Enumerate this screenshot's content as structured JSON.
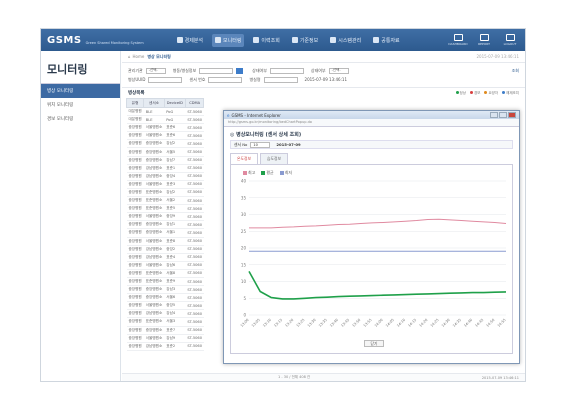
{
  "app": {
    "logo": "GSMS",
    "logo_sub": "Green Shared Monitoring System",
    "menu": [
      "경제분석",
      "모니터링",
      "이력조회",
      "기준정보",
      "시스템관리",
      "공통자료"
    ],
    "right_icons": [
      "DASHBOARD",
      "REPORT",
      "LOGOUT"
    ]
  },
  "sidebar": {
    "title": "모니터링",
    "items": [
      "병상 모니터링",
      "위치 모니터링",
      "경보 모니터링"
    ]
  },
  "crumb": {
    "home": "Home",
    "current": "병상 모니터링",
    "info": "2015-07-09 13:46:11"
  },
  "filters": {
    "org_label": "관리기관",
    "org_value": "-선택-",
    "ward_label": "병동/병실정보",
    "status_label": "상태여부",
    "status_value": "-선택-",
    "search_label": "조회",
    "name_label": "병상UUID",
    "bedid_label": "센서 번호",
    "ip_label": "병실명",
    "time_value": "2015-07-09 13:46:11"
  },
  "list": {
    "title": "병상목록",
    "legend": [
      "정상",
      "경보",
      "요양자",
      "해제조치"
    ],
    "legend_colors": [
      "#1fa04a",
      "#d94040",
      "#e08a1e",
      "#3d7cc9"
    ],
    "headers": [
      "유형",
      "센서소",
      "DeviceID",
      "CDMA"
    ],
    "rows": [
      [
        "대분병원",
        "BLE",
        "PoG",
        "ST-5060"
      ],
      [
        "대분병원",
        "BLE",
        "PoG",
        "ST-5060"
      ],
      [
        "중앙병원",
        "서울병원소",
        "표준6",
        "ST-5060"
      ],
      [
        "중앙병원",
        "서울병원소",
        "표준6",
        "ST-5060"
      ],
      [
        "중앙병원",
        "중앙병원소",
        "강남2",
        "ST-5060"
      ],
      [
        "중앙병원",
        "중앙병원소",
        "서울5",
        "ST-5060"
      ],
      [
        "중앙병원",
        "중앙병원소",
        "강남7",
        "ST-5060"
      ],
      [
        "중앙병원",
        "강남병원소",
        "표준1",
        "ST-5060"
      ],
      [
        "중앙병원",
        "강남병원소",
        "중앙4",
        "ST-5060"
      ],
      [
        "중앙병원",
        "서울병원소",
        "표준3",
        "ST-5060"
      ],
      [
        "중앙병원",
        "표준병원소",
        "강남2",
        "ST-5060"
      ],
      [
        "중앙병원",
        "표준병원소",
        "서울2",
        "ST-5060"
      ],
      [
        "중앙병원",
        "표준병원소",
        "표준5",
        "ST-5060"
      ],
      [
        "중앙병원",
        "서울병원소",
        "중앙9",
        "ST-5060"
      ],
      [
        "중앙병원",
        "중앙병원소",
        "강남1",
        "ST-5060"
      ],
      [
        "중앙병원",
        "중앙병원소",
        "서울1",
        "ST-5060"
      ],
      [
        "중앙병원",
        "서울병원소",
        "표준8",
        "ST-5060"
      ],
      [
        "중앙병원",
        "강남병원소",
        "중앙2",
        "ST-5060"
      ],
      [
        "중앙병원",
        "강남병원소",
        "표준4",
        "ST-5060"
      ],
      [
        "중앙병원",
        "서울병원소",
        "강남6",
        "ST-5060"
      ],
      [
        "중앙병원",
        "표준병원소",
        "서울8",
        "ST-5060"
      ],
      [
        "중앙병원",
        "표준병원소",
        "표준9",
        "ST-5060"
      ],
      [
        "중앙병원",
        "중앙병원소",
        "강남3",
        "ST-5060"
      ],
      [
        "중앙병원",
        "중앙병원소",
        "서울6",
        "ST-5060"
      ],
      [
        "중앙병원",
        "서울병원소",
        "중앙5",
        "ST-5060"
      ],
      [
        "중앙병원",
        "강남병원소",
        "강남4",
        "ST-5060"
      ],
      [
        "중앙병원",
        "표준병원소",
        "서울3",
        "ST-5060"
      ],
      [
        "중앙병원",
        "중앙병원소",
        "표준7",
        "ST-5060"
      ],
      [
        "중앙병원",
        "서울병원소",
        "강남9",
        "ST-5060"
      ],
      [
        "중앙병원",
        "강남병원소",
        "표준2",
        "ST-5060"
      ]
    ]
  },
  "popup": {
    "window_title": "GSMS - Internet Explorer",
    "url": "http://gsms.go.kr/monitoring/bedChartPopup.do",
    "heading": "병상모니터링 (센서 상세 조회)",
    "filter_label": "센서 No",
    "filter_value": "10",
    "date": "2015-07-09",
    "tabs": [
      "온도정보",
      "습도정보"
    ],
    "legend": [
      "최고",
      "평균",
      "최저"
    ],
    "legend_colors": [
      "#e08aa0",
      "#1fa04a",
      "#8a9bd0"
    ],
    "close_button": "닫기"
  },
  "status": {
    "text": "1 - 30 / 전체 408 건",
    "time": "2015-07-09 13:46:11"
  },
  "chart_data": {
    "type": "line",
    "ylim": [
      0,
      40
    ],
    "y_ticks": [
      "0",
      "5",
      "10",
      "15",
      "20",
      "25",
      "30",
      "35",
      "40"
    ],
    "x": [
      "13:00",
      "13:05",
      "13:10",
      "13:15",
      "13:20",
      "13:25",
      "13:30",
      "13:35",
      "13:40",
      "13:45",
      "13:50",
      "13:55",
      "14:00",
      "14:05",
      "14:10",
      "14:15",
      "14:20",
      "14:25",
      "14:30",
      "14:35",
      "14:40",
      "14:45",
      "14:50",
      "14:55"
    ],
    "series": [
      {
        "name": "최고",
        "values": [
          26,
          26,
          26,
          26.2,
          26.3,
          26.5,
          26.6,
          26.8,
          27,
          27.1,
          27.3,
          27.5,
          27.6,
          27.8,
          28,
          28.2,
          28.5,
          28.6,
          28.4,
          28.2,
          28,
          27.8,
          27.6,
          27.3
        ]
      },
      {
        "name": "평균",
        "values": [
          13,
          7,
          5.2,
          4.8,
          4.8,
          5,
          5.2,
          5.3,
          5.5,
          5.6,
          5.7,
          5.8,
          5.9,
          6,
          6.1,
          6.2,
          6.3,
          6.4,
          6.5,
          6.6,
          6.7,
          6.7,
          6.8,
          6.9
        ]
      },
      {
        "name": "최저",
        "values": [
          19,
          19,
          19,
          19,
          19,
          19,
          19,
          19,
          19,
          19,
          19,
          19,
          19,
          19,
          19,
          19,
          19,
          19,
          19,
          19,
          19,
          19,
          19,
          19
        ]
      }
    ]
  }
}
